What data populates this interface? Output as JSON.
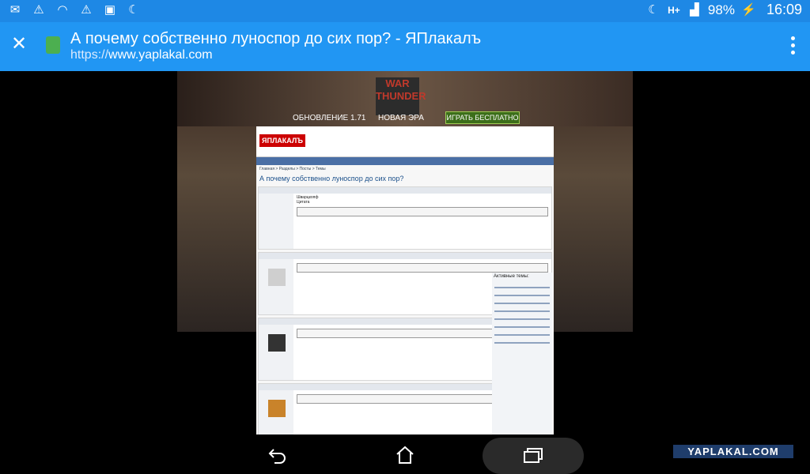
{
  "status_bar": {
    "battery": "98%",
    "time": "16:09",
    "left_icons": [
      "mail-icon",
      "warning-icon",
      "wifi-icon",
      "warning-icon",
      "image-icon",
      "moon-icon"
    ],
    "right_icons": [
      "moon-icon",
      "hplus-icon",
      "signal-icon",
      "battery-charging-icon"
    ]
  },
  "browser": {
    "title": "А почему собственно луноспор до сих пор? - ЯПлакалъ",
    "url_scheme": "https://",
    "url_host": "www.yaplakal.com"
  },
  "page": {
    "promo_update": "ОБНОВЛЕНИЕ 1.71",
    "promo_era": "НОВАЯ ЭРА",
    "promo_play": "ИГРАТЬ БЕСПЛАТНО",
    "wt_logo": "WAR THUNDER",
    "thread_title": "А почему собственно луноспор до сих пор?",
    "forum_logo": "ЯПЛАКАЛЪ",
    "breadcrumb": "Главная > Разделы > Посты > Темы",
    "post1_quote_label": "Цитата",
    "post1_author_label": "Шварцкопф",
    "side_title": "Активные темы:"
  },
  "watermark": "YAPLAKAL.COM"
}
